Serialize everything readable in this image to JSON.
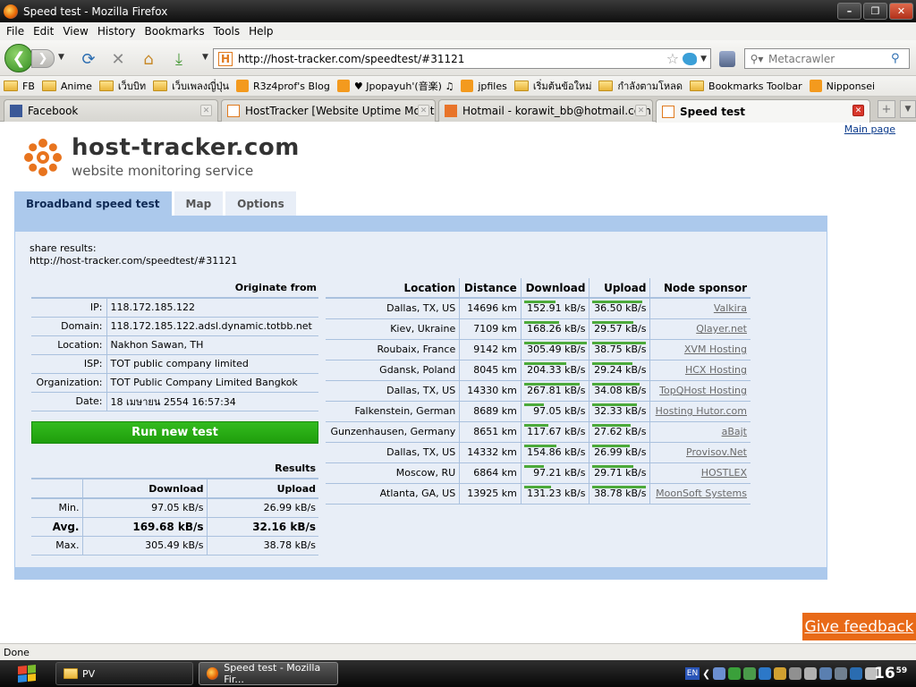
{
  "window": {
    "title": "Speed test - Mozilla Firefox"
  },
  "menu": [
    "File",
    "Edit",
    "View",
    "History",
    "Bookmarks",
    "Tools",
    "Help"
  ],
  "navbar": {
    "url": "http://host-tracker.com/speedtest/#31121",
    "search_placeholder": "Metacrawler"
  },
  "bookmarks": [
    {
      "label": "FB",
      "icon": "folder-icon"
    },
    {
      "label": "Anime",
      "icon": "folder-icon"
    },
    {
      "label": "เว็บบิท",
      "icon": "folder-icon"
    },
    {
      "label": "เว็บเพลงญี่ปุ่น",
      "icon": "folder-icon"
    },
    {
      "label": "R3z4prof's Blog",
      "icon": "rss-icon"
    },
    {
      "label": "♥ Jpopayuh'(音楽) ♫",
      "icon": "rss-icon"
    },
    {
      "label": "jpfiles",
      "icon": "rss-icon"
    },
    {
      "label": "เริ่มต้นข้อใหม่",
      "icon": "folder-icon"
    },
    {
      "label": "กำลังตามโหลด",
      "icon": "folder-icon"
    },
    {
      "label": "Bookmarks Toolbar",
      "icon": "folder-icon"
    },
    {
      "label": "Nipponsei",
      "icon": "rss-icon"
    }
  ],
  "tabs": [
    {
      "label": "Facebook"
    },
    {
      "label": "HostTracker [Website Uptime Monitori..."
    },
    {
      "label": "Hotmail - korawit_bb@hotmail.com - ..."
    },
    {
      "label": "Speed test"
    }
  ],
  "page": {
    "main_page_link": "Main page",
    "logo_title": "host-tracker.com",
    "logo_subtitle": "website monitoring service",
    "tabs": [
      "Broadband speed test",
      "Map",
      "Options"
    ],
    "share_label": "share results:",
    "share_url": "http://host-tracker.com/speedtest/#31121",
    "originate": {
      "header": "Originate from",
      "rows": [
        {
          "k": "IP:",
          "v": "118.172.185.122"
        },
        {
          "k": "Domain:",
          "v": "118.172.185.122.adsl.dynamic.totbb.net"
        },
        {
          "k": "Location:",
          "v": "Nakhon Sawan, TH"
        },
        {
          "k": "ISP:",
          "v": "TOT public company limited"
        },
        {
          "k": "Organization:",
          "v": "TOT Public Company Limited Bangkok"
        },
        {
          "k": "Date:",
          "v": "18 เมษายน 2554 16:57:34"
        }
      ]
    },
    "run_button": "Run new test",
    "results": {
      "header": "Results",
      "col_download": "Download",
      "col_upload": "Upload",
      "rows": [
        {
          "k": "Min.",
          "d": "97.05 kB/s",
          "u": "26.99 kB/s"
        },
        {
          "k": "Avg.",
          "d": "169.68 kB/s",
          "u": "32.16 kB/s"
        },
        {
          "k": "Max.",
          "d": "305.49 kB/s",
          "u": "38.78 kB/s"
        }
      ]
    },
    "locations": {
      "headers": [
        "Location",
        "Distance",
        "Download",
        "Upload",
        "Node sponsor"
      ],
      "rows": [
        {
          "loc": "Dallas, TX, US",
          "dist": "14696 km",
          "down": "152.91 kB/s",
          "up": "36.50 kB/s",
          "sponsor": "Valkira",
          "down_frac": 0.5,
          "up_frac": 0.94
        },
        {
          "loc": "Kiev, Ukraine",
          "dist": "7109 km",
          "down": "168.26 kB/s",
          "up": "29.57 kB/s",
          "sponsor": "Qlayer.net",
          "down_frac": 0.55,
          "up_frac": 0.76
        },
        {
          "loc": "Roubaix, France",
          "dist": "9142 km",
          "down": "305.49 kB/s",
          "up": "38.75 kB/s",
          "sponsor": "XVM Hosting",
          "down_frac": 1.0,
          "up_frac": 1.0
        },
        {
          "loc": "Gdansk, Poland",
          "dist": "8045 km",
          "down": "204.33 kB/s",
          "up": "29.24 kB/s",
          "sponsor": "HCX Hosting",
          "down_frac": 0.67,
          "up_frac": 0.75
        },
        {
          "loc": "Dallas, TX, US",
          "dist": "14330 km",
          "down": "267.81 kB/s",
          "up": "34.08 kB/s",
          "sponsor": "TopQHost Hosting",
          "down_frac": 0.88,
          "up_frac": 0.88
        },
        {
          "loc": "Falkenstein, German",
          "dist": "8689 km",
          "down": "97.05 kB/s",
          "up": "32.33 kB/s",
          "sponsor": "Hosting Hutor.com",
          "down_frac": 0.32,
          "up_frac": 0.83
        },
        {
          "loc": "Gunzenhausen, Germany",
          "dist": "8651 km",
          "down": "117.67 kB/s",
          "up": "27.62 kB/s",
          "sponsor": "aBajt",
          "down_frac": 0.39,
          "up_frac": 0.71
        },
        {
          "loc": "Dallas, TX, US",
          "dist": "14332 km",
          "down": "154.86 kB/s",
          "up": "26.99 kB/s",
          "sponsor": "Provisov.Net",
          "down_frac": 0.51,
          "up_frac": 0.7
        },
        {
          "loc": "Moscow, RU",
          "dist": "6864 km",
          "down": "97.21 kB/s",
          "up": "29.71 kB/s",
          "sponsor": "HOSTLEX",
          "down_frac": 0.32,
          "up_frac": 0.77
        },
        {
          "loc": "Atlanta, GA, US",
          "dist": "13925 km",
          "down": "131.23 kB/s",
          "up": "38.78 kB/s",
          "sponsor": "MoonSoft Systems",
          "down_frac": 0.43,
          "up_frac": 1.0
        }
      ]
    },
    "feedback": "Give feedback"
  },
  "status": "Done",
  "taskbar": {
    "items": [
      "PV",
      "Speed test - Mozilla Fir..."
    ],
    "lang": "EN",
    "clock": "16",
    "clock_min": "59"
  },
  "colors": {
    "accent": "#acc9ec",
    "bar": "#4caa3a",
    "run_button": "#27a814",
    "feedback": "#e86a18"
  }
}
